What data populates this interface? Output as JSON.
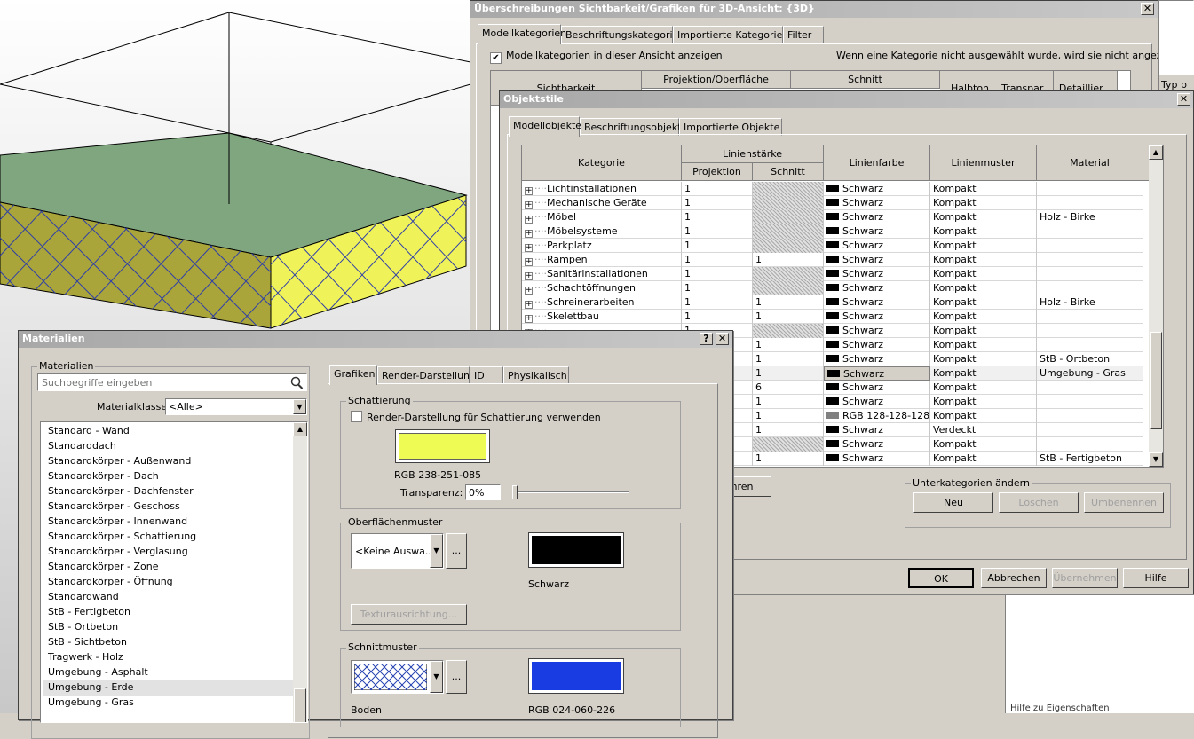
{
  "colors": {
    "viewport_top": "#7fa67f",
    "viewport_side_left": "#a9a53a",
    "viewport_side_right": "#f0f25a",
    "hatch_line": "#2f3fa8",
    "surface_color": "#eefb55",
    "surface_pattern": "#000000",
    "cut_color": "#183ce2"
  },
  "override": {
    "title": "Überschreibungen Sichtbarkeit/Grafiken für 3D-Ansicht: {3D}",
    "tabs": [
      "Modellkategorien",
      "Beschriftungskategorien",
      "Importierte Kategorien",
      "Filter"
    ],
    "show_checkbox_label": "Modellkategorien in dieser Ansicht anzeigen",
    "hint": "Wenn eine Kategorie nicht ausgewählt wurde, wird sie nicht angezeigt.",
    "headers": {
      "visibility": "Sichtbarkeit",
      "projection": "Projektion/Oberfläche",
      "cut": "Schnitt",
      "halftone": "Halbton",
      "transparency": "Transpar...",
      "detail": "Detaillier..."
    },
    "right_snip": "Typ b",
    "bottom_snip": "Hilfe zu Eigenschaften"
  },
  "objstyles": {
    "title": "Objektstile",
    "tabs": [
      "Modellobjekte",
      "Beschriftungsobjekte",
      "Importierte Objekte"
    ],
    "headers": {
      "category": "Kategorie",
      "lineweight": "Linienstärke",
      "projection": "Projektion",
      "cut": "Schnitt",
      "linecolor": "Linienfarbe",
      "linepattern": "Linienmuster",
      "material": "Material"
    },
    "rows": [
      {
        "cat": "Lichtinstallationen",
        "proj": "1",
        "cut": "",
        "color": "Schwarz",
        "pattern": "Kompakt",
        "mat": ""
      },
      {
        "cat": "Mechanische Geräte",
        "proj": "1",
        "cut": "",
        "color": "Schwarz",
        "pattern": "Kompakt",
        "mat": ""
      },
      {
        "cat": "Möbel",
        "proj": "1",
        "cut": "",
        "color": "Schwarz",
        "pattern": "Kompakt",
        "mat": "Holz - Birke"
      },
      {
        "cat": "Möbelsysteme",
        "proj": "1",
        "cut": "",
        "color": "Schwarz",
        "pattern": "Kompakt",
        "mat": ""
      },
      {
        "cat": "Parkplatz",
        "proj": "1",
        "cut": "",
        "color": "Schwarz",
        "pattern": "Kompakt",
        "mat": ""
      },
      {
        "cat": "Rampen",
        "proj": "1",
        "cut": "1",
        "color": "Schwarz",
        "pattern": "Kompakt",
        "mat": ""
      },
      {
        "cat": "Sanitärinstallationen",
        "proj": "1",
        "cut": "",
        "color": "Schwarz",
        "pattern": "Kompakt",
        "mat": ""
      },
      {
        "cat": "Schachtöffnungen",
        "proj": "1",
        "cut": "",
        "color": "Schwarz",
        "pattern": "Kompakt",
        "mat": ""
      },
      {
        "cat": "Schreinerarbeiten",
        "proj": "1",
        "cut": "1",
        "color": "Schwarz",
        "pattern": "Kompakt",
        "mat": "Holz - Birke"
      },
      {
        "cat": "Skelettbau",
        "proj": "1",
        "cut": "1",
        "color": "Schwarz",
        "pattern": "Kompakt",
        "mat": ""
      },
      {
        "cat": "",
        "proj": "1",
        "cut": "",
        "color": "Schwarz",
        "pattern": "Kompakt",
        "mat": ""
      },
      {
        "cat": "",
        "proj": "",
        "cut": "1",
        "color": "Schwarz",
        "pattern": "Kompakt",
        "mat": ""
      },
      {
        "cat": "",
        "proj": "",
        "cut": "1",
        "color": "Schwarz",
        "pattern": "Kompakt",
        "mat": "StB - Ortbeton"
      },
      {
        "cat": "",
        "proj": "",
        "cut": "1",
        "color": "Schwarz",
        "pattern": "Kompakt",
        "mat": "Umgebung - Gras"
      },
      {
        "cat": "",
        "proj": "",
        "cut": "6",
        "color": "Schwarz",
        "pattern": "Kompakt",
        "mat": ""
      },
      {
        "cat": "",
        "proj": "",
        "cut": "1",
        "color": "Schwarz",
        "pattern": "Kompakt",
        "mat": ""
      },
      {
        "cat": "",
        "proj": "",
        "cut": "1",
        "color": "RGB 128-128-128",
        "pattern": "Kompakt",
        "mat": ""
      },
      {
        "cat": "",
        "proj": "",
        "cut": "1",
        "color": "Schwarz",
        "pattern": "Verdeckt",
        "mat": ""
      },
      {
        "cat": "",
        "proj": "",
        "cut": "",
        "color": "Schwarz",
        "pattern": "Kompakt",
        "mat": ""
      },
      {
        "cat": "",
        "proj": "",
        "cut": "1",
        "color": "Schwarz",
        "pattern": "Kompakt",
        "mat": "StB - Fertigbeton"
      }
    ],
    "sub_legend": "Unterkategorien ändern",
    "btn_new": "Neu",
    "btn_delete": "Löschen",
    "btn_rename": "Umbenennen",
    "btn_ok": "OK",
    "btn_cancel": "Abbrechen",
    "btn_apply": "Übernehmen",
    "btn_help": "Hilfe",
    "partial_btn": "hren"
  },
  "materials": {
    "title": "Materialien",
    "group_label": "Materialien",
    "search_placeholder": "Suchbegriffe eingeben",
    "class_label": "Materialklasse:",
    "class_value": "<Alle>",
    "list": [
      "Standard - Wand",
      "Standarddach",
      "Standardkörper - Außenwand",
      "Standardkörper - Dach",
      "Standardkörper - Dachfenster",
      "Standardkörper - Geschoss",
      "Standardkörper - Innenwand",
      "Standardkörper - Schattierung",
      "Standardkörper - Verglasung",
      "Standardkörper - Zone",
      "Standardkörper - Öffnung",
      "Standardwand",
      "StB - Fertigbeton",
      "StB - Ortbeton",
      "StB - Sichtbeton",
      "Tragwerk - Holz",
      "Umgebung - Asphalt",
      "Umgebung - Erde",
      "Umgebung - Gras"
    ],
    "selected_index": 17,
    "tabs": [
      "Grafiken",
      "Render-Darstellung",
      "ID",
      "Physikalisch"
    ],
    "shading_legend": "Schattierung",
    "render_checkbox": "Render-Darstellung für Schattierung verwenden",
    "shading_rgb": "RGB 238-251-085",
    "transparency_label": "Transparenz:",
    "transparency_value": "0%",
    "transparency_level": 0,
    "surface_legend": "Oberflächenmuster",
    "surface_select": "<Keine Auswa...",
    "surface_color_label": "Schwarz",
    "texture_btn": "Texturausrichtung...",
    "cut_legend": "Schnittmuster",
    "cut_label": "Boden",
    "cut_rgb": "RGB 024-060-226",
    "dots": "..."
  }
}
